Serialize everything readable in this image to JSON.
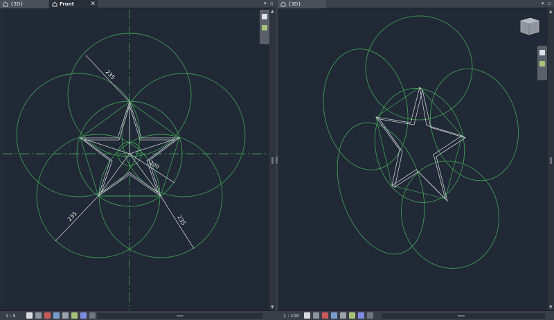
{
  "left_pane": {
    "tabs": [
      {
        "label": "{3D}",
        "active": false
      },
      {
        "label": "Front",
        "active": true
      }
    ],
    "scale": "1 : 5",
    "dimensions": [
      "235",
      "200",
      "235",
      "235"
    ]
  },
  "right_pane": {
    "tabs": [
      {
        "label": "{3D}",
        "active": true
      }
    ],
    "scale": "1 : 100"
  },
  "colors": {
    "background": "#212936",
    "circle_stroke": "#3f9b52",
    "star_stroke": "#c8cdd2",
    "centerline": "#3f9b52"
  },
  "icons": [
    "3d-view-icon",
    "home-icon",
    "close-icon",
    "viewcube-icon",
    "steering-wheel-icon",
    "zoom-icon"
  ]
}
